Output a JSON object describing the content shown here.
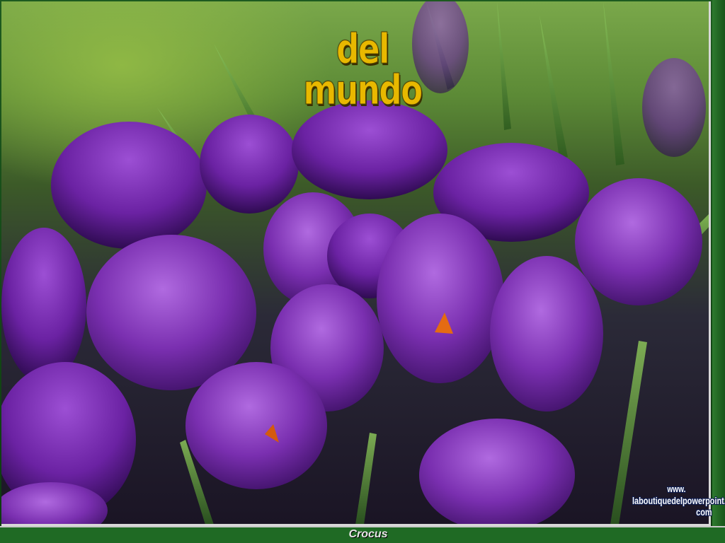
{
  "slide": {
    "title": "del mundo",
    "caption": "Crocus",
    "watermark": {
      "line1": "www.",
      "line2": "laboutiquedelpowerpoint.",
      "line3": "com"
    }
  },
  "colors": {
    "title": "#e8b800",
    "petal_main": "#7a2fb0",
    "petal_light": "#a45ad6",
    "grass": "#4a8a2e",
    "caption_bar": "#1f6a24"
  },
  "scene": {
    "subject": "crocus-flowers",
    "elements": [
      "grass-blades",
      "crocus-cluster",
      "stamen"
    ]
  }
}
